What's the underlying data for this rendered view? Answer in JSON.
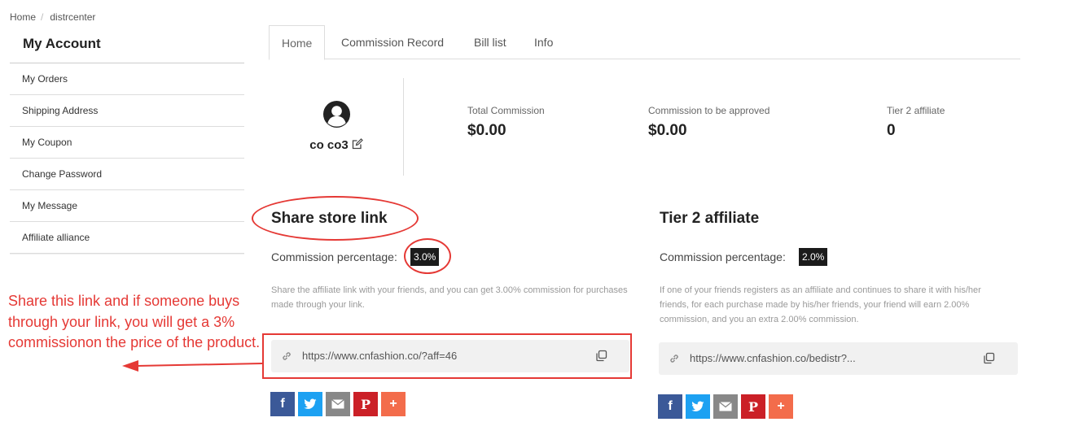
{
  "breadcrumb": {
    "home": "Home",
    "current": "distrcenter"
  },
  "sidebar": {
    "title": "My Account",
    "items": [
      {
        "label": "My Orders"
      },
      {
        "label": "Shipping Address"
      },
      {
        "label": "My Coupon"
      },
      {
        "label": "Change Password"
      },
      {
        "label": "My Message"
      },
      {
        "label": "Affiliate alliance"
      }
    ]
  },
  "tabs": [
    {
      "label": "Home",
      "active": true
    },
    {
      "label": "Commission Record"
    },
    {
      "label": "Bill list"
    },
    {
      "label": "Info"
    }
  ],
  "profile": {
    "name": "co co3"
  },
  "stats": [
    {
      "label": "Total Commission",
      "value": "$0.00"
    },
    {
      "label": "Commission to be approved",
      "value": "$0.00"
    },
    {
      "label": "Tier 2 affiliate",
      "value": "0"
    }
  ],
  "share_store": {
    "title": "Share store link",
    "commission_label": "Commission percentage:",
    "commission_value": "3.0%",
    "description": "Share the affiliate link with your friends, and you can get 3.00% commission for purchases made through your link.",
    "link": "https://www.cnfashion.co/?aff=46"
  },
  "tier2": {
    "title": "Tier 2 affiliate",
    "commission_label": "Commission percentage:",
    "commission_value": "2.0%",
    "description": "If one of your friends registers as an affiliate and continues to share it with his/her friends, for each purchase made by his/her friends, your friend will earn 2.00% commission, and you an extra 2.00% commission.",
    "link": "https://www.cnfashion.co/bedistr?..."
  },
  "share_buttons": [
    {
      "icon": "facebook-icon",
      "color": "#3b5998"
    },
    {
      "icon": "twitter-icon",
      "color": "#1da1f2"
    },
    {
      "icon": "email-icon",
      "color": "#888888"
    },
    {
      "icon": "pinterest-icon",
      "color": "#cb2027"
    },
    {
      "icon": "plus-icon",
      "color": "#f36c4b"
    }
  ],
  "annotation": {
    "text": "Share this link and if someone buys through your link, you will get a 3% commissionon the price of the product.",
    "color": "#e53935"
  }
}
